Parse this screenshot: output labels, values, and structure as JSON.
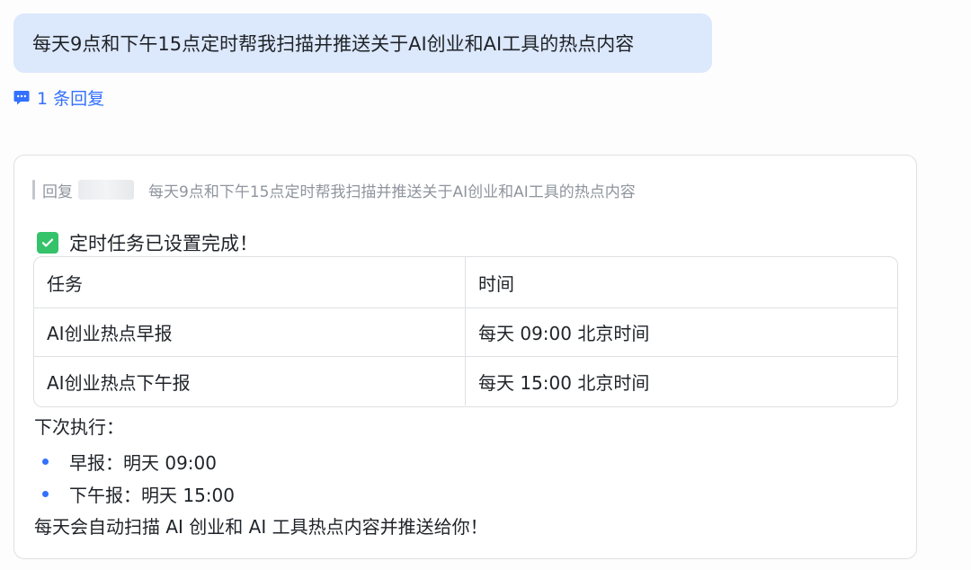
{
  "message": {
    "text": "每天9点和下午15点定时帮我扫描并推送关于AI创业和AI工具的热点内容"
  },
  "reply_link": {
    "icon": "comment-icon",
    "label": "1 条回复"
  },
  "reply_card": {
    "quote": {
      "label": "回复",
      "text": "每天9点和下午15点定时帮我扫描并推送关于AI创业和AI工具的热点内容"
    },
    "status": {
      "icon": "check-icon",
      "text": "定时任务已设置完成！"
    },
    "table": {
      "headers": [
        "任务",
        "时间"
      ],
      "rows": [
        [
          "AI创业热点早报",
          "每天 09:00 北京时间"
        ],
        [
          "AI创业热点下午报",
          "每天 15:00 北京时间"
        ]
      ]
    },
    "next_title": "下次执行：",
    "next_items": [
      "早报：明天 09:00",
      "下午报：明天 15:00"
    ],
    "footer": "每天会自动扫描 AI 创业和 AI 工具热点内容并推送给你！"
  },
  "colors": {
    "bubble_bg": "#dce8fb",
    "accent": "#3370ff",
    "success": "#34c26a",
    "border": "#dee0e3"
  }
}
